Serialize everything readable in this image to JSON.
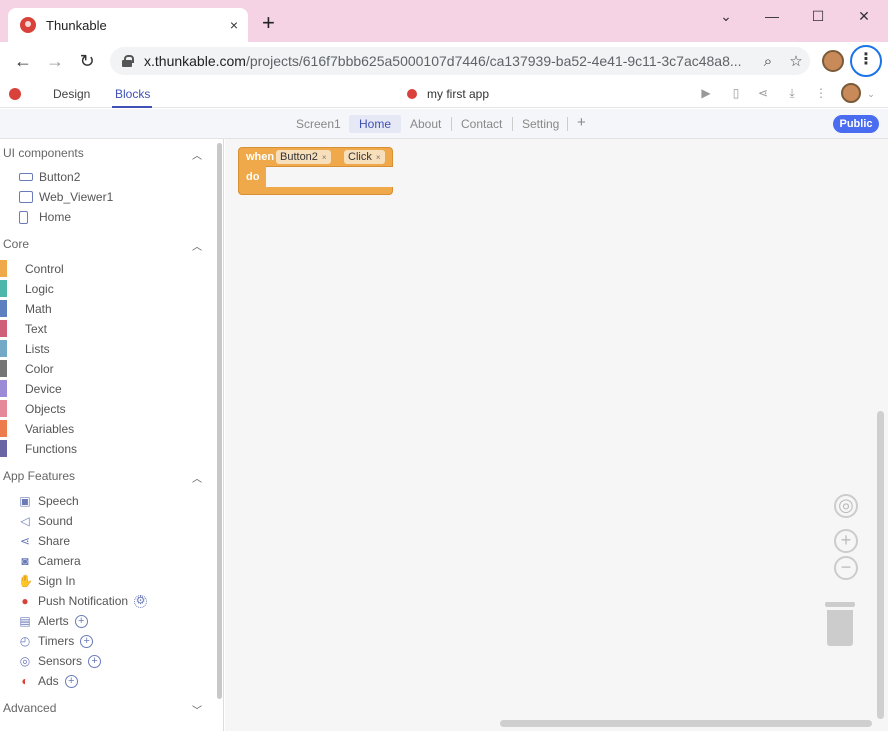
{
  "browser": {
    "tab_title": "Thunkable",
    "close_glyph": "×",
    "new_tab_glyph": "+",
    "window_controls": [
      "⌄",
      "—",
      "☐",
      "✕"
    ],
    "url_host": "x.thunkable.com",
    "url_path": "/projects/616f7bbb625a5000107d7446/ca137939-ba52-4e41-9c11-3c7ac48a8..."
  },
  "app": {
    "mode_tabs": [
      "Design",
      "Blocks"
    ],
    "project_name": "my first app",
    "screen_tabs": [
      "Screen1",
      "Home",
      "About",
      "Contact",
      "Setting"
    ],
    "add_screen": "+",
    "public_label": "Public"
  },
  "sidebar": {
    "ui_section": "UI components",
    "ui_items": [
      "Button2",
      "Web_Viewer1",
      "Home"
    ],
    "core_section": "Core",
    "core_items": [
      {
        "label": "Control",
        "color": "#efa94a"
      },
      {
        "label": "Logic",
        "color": "#4db6ac"
      },
      {
        "label": "Math",
        "color": "#5c7fc0"
      },
      {
        "label": "Text",
        "color": "#d0607a"
      },
      {
        "label": "Lists",
        "color": "#73a9c6"
      },
      {
        "label": "Color",
        "color": "#757575"
      },
      {
        "label": "Device",
        "color": "#9b8ad6"
      },
      {
        "label": "Objects",
        "color": "#e5899a"
      },
      {
        "label": "Variables",
        "color": "#ec7b4e"
      },
      {
        "label": "Functions",
        "color": "#6a66a6"
      }
    ],
    "features_section": "App Features",
    "feature_items": [
      "Speech",
      "Sound",
      "Share",
      "Camera",
      "Sign In",
      "Push Notification",
      "Alerts",
      "Timers",
      "Sensors",
      "Ads"
    ],
    "advanced_section": "Advanced"
  },
  "block": {
    "when": "when",
    "component": "Button2",
    "event": "Click",
    "do": "do",
    "remove_glyph": "×"
  },
  "workspace": {
    "zoom_in": "+",
    "zoom_out": "−",
    "center": "◎"
  }
}
